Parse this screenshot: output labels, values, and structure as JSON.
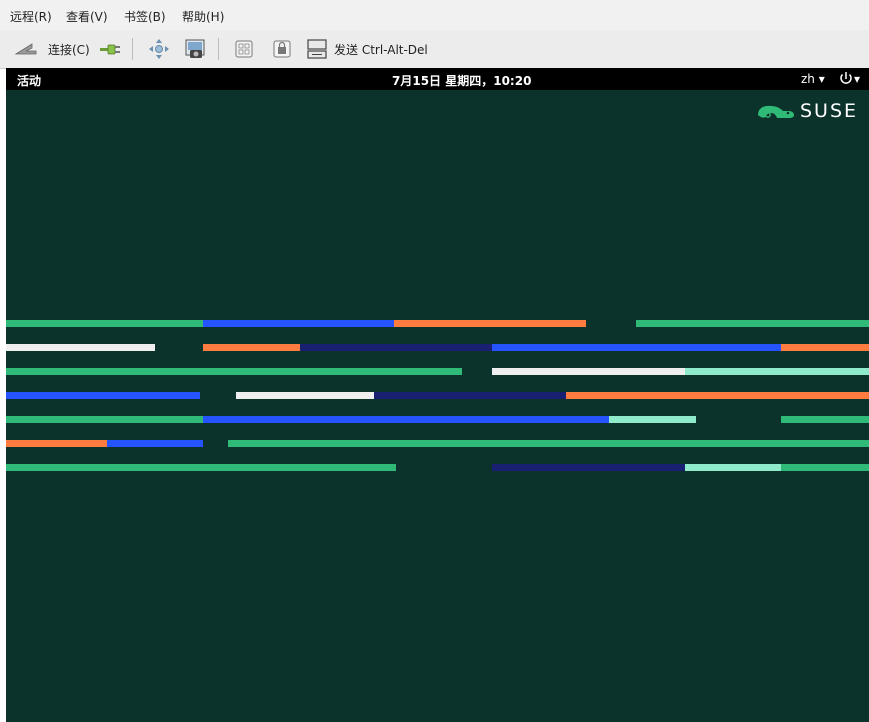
{
  "menu": {
    "remote": "远程(R)",
    "view": "查看(V)",
    "bookmarks": "书签(B)",
    "help": "帮助(H)"
  },
  "toolbar": {
    "connect_label": "连接(C)",
    "send_keys_label": "发送 Ctrl-Alt-Del",
    "icons": [
      "disconnect-icon",
      "connect-plug-icon",
      "fullscreen-move-icon",
      "screenshot-icon",
      "keyboard-grab-icon",
      "lock-icon",
      "send-keys-icon"
    ]
  },
  "desktop": {
    "activities": "活动",
    "clock": "7月15日 星期四，10:20",
    "language": "zh ▾",
    "power_menu": "▾",
    "logo_text": "SUSE"
  },
  "colors": {
    "background": "#0c322c",
    "green": "#30ba78",
    "blue": "#2453ff",
    "orange": "#fe7c3f",
    "navy": "#192072",
    "white": "#efefef",
    "mint": "#90ebcd"
  }
}
